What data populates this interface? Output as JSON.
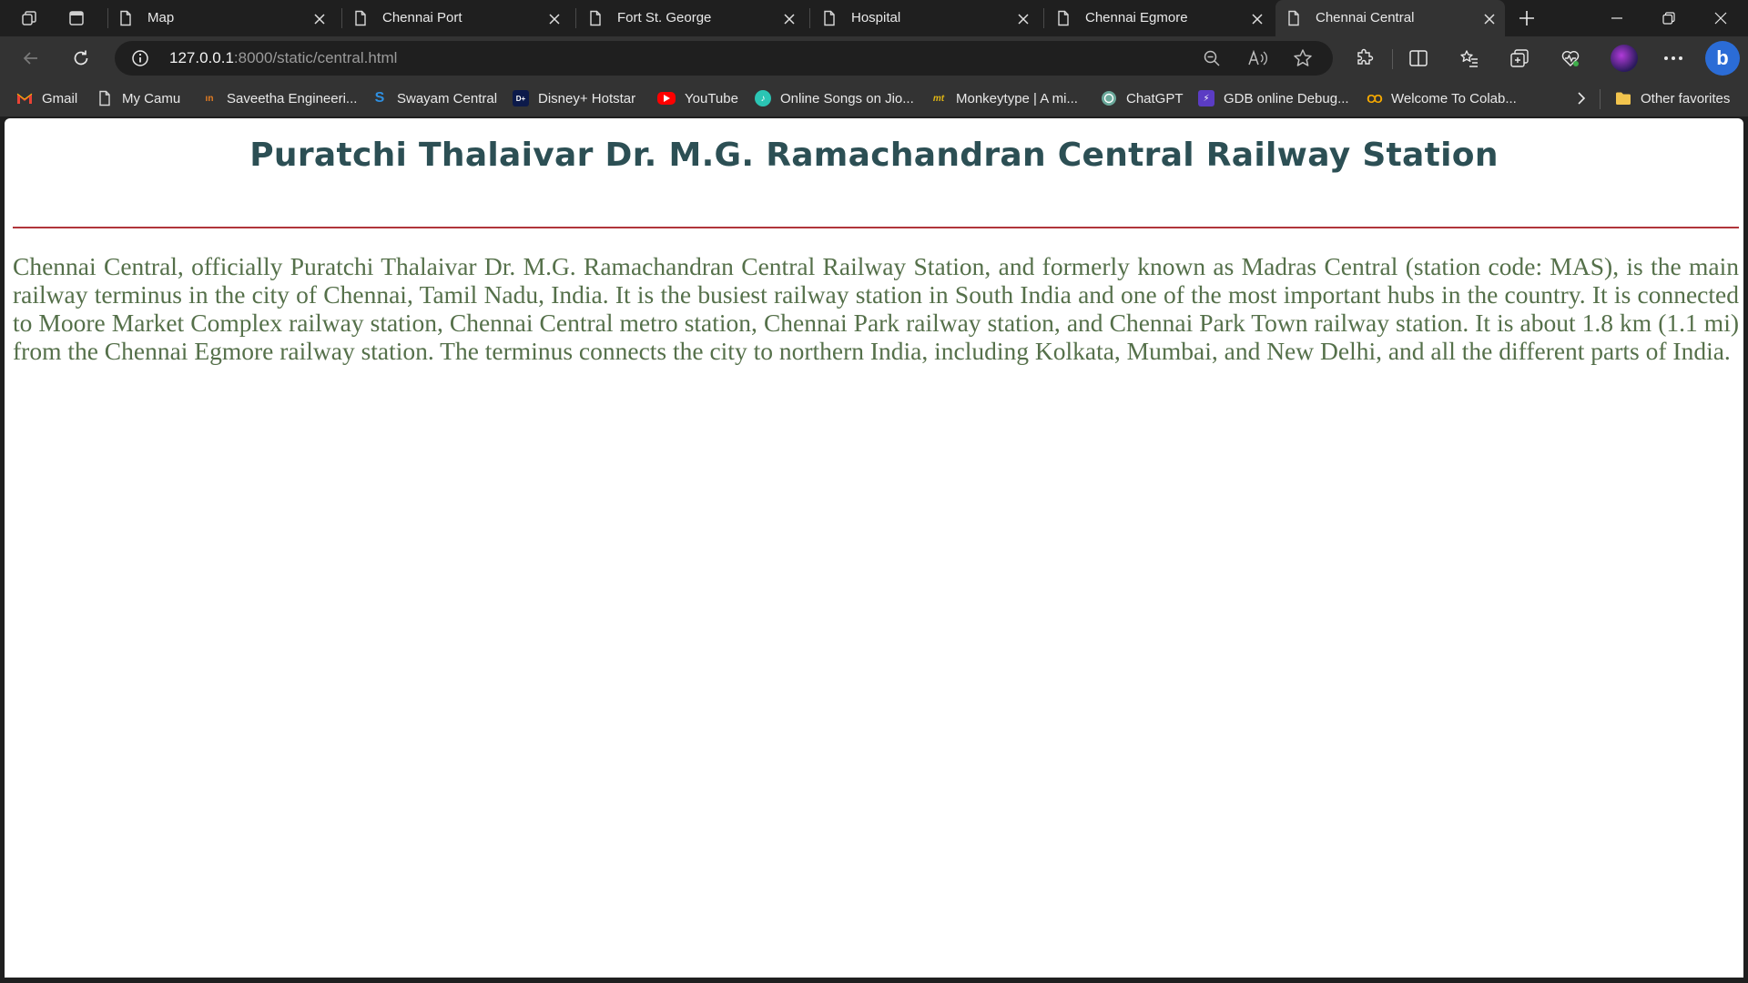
{
  "browser": {
    "tabs": [
      {
        "title": "Map"
      },
      {
        "title": "Chennai Port"
      },
      {
        "title": "Fort St. George"
      },
      {
        "title": "Hospital"
      },
      {
        "title": "Chennai Egmore"
      },
      {
        "title": "Chennai Central",
        "active": true
      }
    ],
    "address": {
      "host": "127.0.0.1",
      "rest": ":8000/static/central.html"
    },
    "bookmarks": [
      {
        "label": "Gmail",
        "icon": "gmail-icon"
      },
      {
        "label": "My Camu",
        "icon": "page-icon"
      },
      {
        "label": "Saveetha Engineeri...",
        "icon": "saveetha-icon"
      },
      {
        "label": "Swayam Central",
        "icon": "swayam-icon"
      },
      {
        "label": "Disney+ Hotstar",
        "icon": "hotstar-icon"
      },
      {
        "label": "YouTube",
        "icon": "youtube-icon"
      },
      {
        "label": "Online Songs on Jio...",
        "icon": "jiosaavn-icon"
      },
      {
        "label": "Monkeytype | A mi...",
        "icon": "monkeytype-icon"
      },
      {
        "label": "ChatGPT",
        "icon": "chatgpt-icon"
      },
      {
        "label": "GDB online Debug...",
        "icon": "gdb-icon"
      },
      {
        "label": "Welcome To Colab...",
        "icon": "colab-icon"
      }
    ],
    "other_favorites": "Other favorites"
  },
  "page": {
    "heading": "Puratchi Thalaivar Dr. M.G. Ramachandran Central Railway Station",
    "body": "Chennai Central, officially Puratchi Thalaivar Dr. M.G. Ramachandran Central Railway Station, and formerly known as Madras Central (station code: MAS), is the main railway terminus in the city of Chennai, Tamil Nadu, India. It is the busiest railway station in South India and one of the most important hubs in the country. It is connected to Moore Market Complex railway station, Chennai Central metro station, Chennai Park railway station, and Chennai Park Town railway station. It is about 1.8 km (1.1 mi) from the Chennai Egmore railway station. The terminus connects the city to northern India, including Kolkata, Mumbai, and New Delhi, and all the different parts of India."
  },
  "colors": {
    "heading": "#2c4f54",
    "body_text": "#55704a",
    "rule": "#b0353a",
    "chrome_dark": "#1f1f1f",
    "chrome_toolbar": "#333333"
  }
}
